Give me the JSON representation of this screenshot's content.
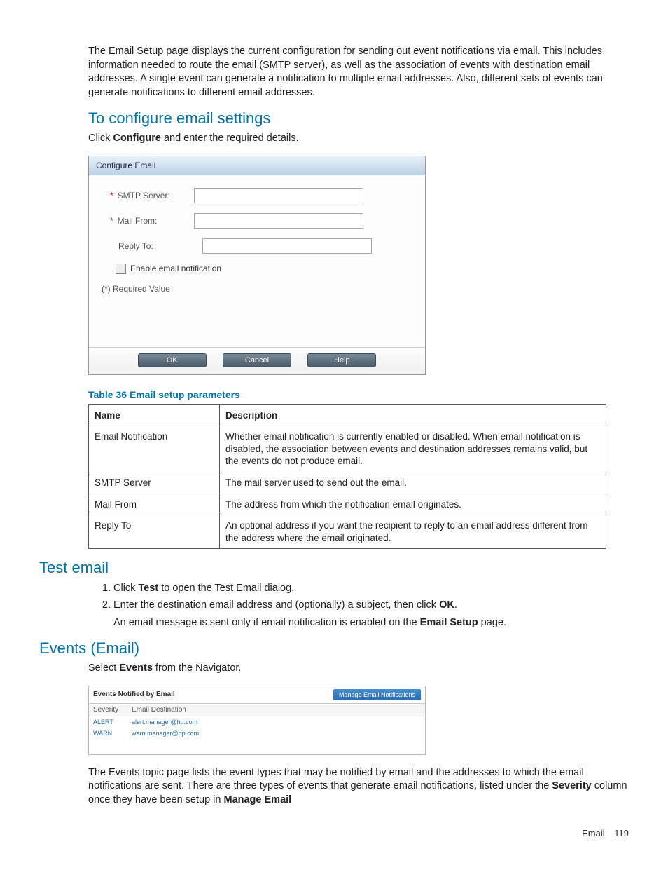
{
  "intro_para": "The Email Setup page displays the current configuration for sending out event notifications via email. This includes information needed to route the email (SMTP server), as well as the association of events with destination email addresses. A single event can generate a notification to multiple email addresses. Also, different sets of events can generate notifications to different email addresses.",
  "sec1": {
    "heading": "To configure email settings",
    "instr_pre": "Click ",
    "instr_bold": "Configure",
    "instr_post": " and enter the required details."
  },
  "dialog": {
    "title": "Configure Email",
    "smtp_label": "SMTP Server:",
    "mail_from_label": "Mail From:",
    "reply_to_label": "Reply To:",
    "enable_label": "Enable email notification",
    "required_note": "(*) Required Value",
    "ok": "OK",
    "cancel": "Cancel",
    "help": "Help"
  },
  "table36": {
    "caption": "Table 36 Email setup parameters",
    "h_name": "Name",
    "h_desc": "Description",
    "rows": [
      {
        "name": "Email Notification",
        "desc": "Whether email notification is currently enabled or disabled. When email notification is disabled, the association between events and destination addresses remains valid, but the events do not produce email."
      },
      {
        "name": "SMTP Server",
        "desc": "The mail server used to send out the email."
      },
      {
        "name": "Mail From",
        "desc": "The address from which the notification email originates."
      },
      {
        "name": "Reply To",
        "desc": "An optional address if you want the recipient to reply to an email address different from the address where the email originated."
      }
    ]
  },
  "test": {
    "heading": "Test email",
    "step1_pre": "Click ",
    "step1_bold": "Test",
    "step1_post": " to open the Test Email dialog.",
    "step2_pre": "Enter the destination email address and (optionally) a subject, then click ",
    "step2_bold": "OK",
    "step2_post": ".",
    "step2_note_pre": "An email message is sent only if email notification is enabled on the ",
    "step2_note_bold": "Email Setup",
    "step2_note_post": " page."
  },
  "events": {
    "heading": "Events (Email)",
    "instr_pre": "Select ",
    "instr_bold": "Events",
    "instr_post": " from the Navigator.",
    "shot": {
      "title": "Events Notified by Email",
      "manage_btn": "Manage Email Notifications",
      "h_sev": "Severity",
      "h_dest": "Email  Destination",
      "rows": [
        {
          "sev": "ALERT",
          "dest": "alert.manager@hp.com"
        },
        {
          "sev": "WARN",
          "dest": "warn.manager@hp.com"
        }
      ]
    },
    "para_pre": "The Events topic page lists the event types that may be notified by email and the addresses to which the email notifications are sent. There are three types of events that generate email notifications, listed under the ",
    "para_b1": "Severity",
    "para_mid": " column once they have been setup in ",
    "para_b2": "Manage Email"
  },
  "footer": {
    "section": "Email",
    "page": "119"
  }
}
